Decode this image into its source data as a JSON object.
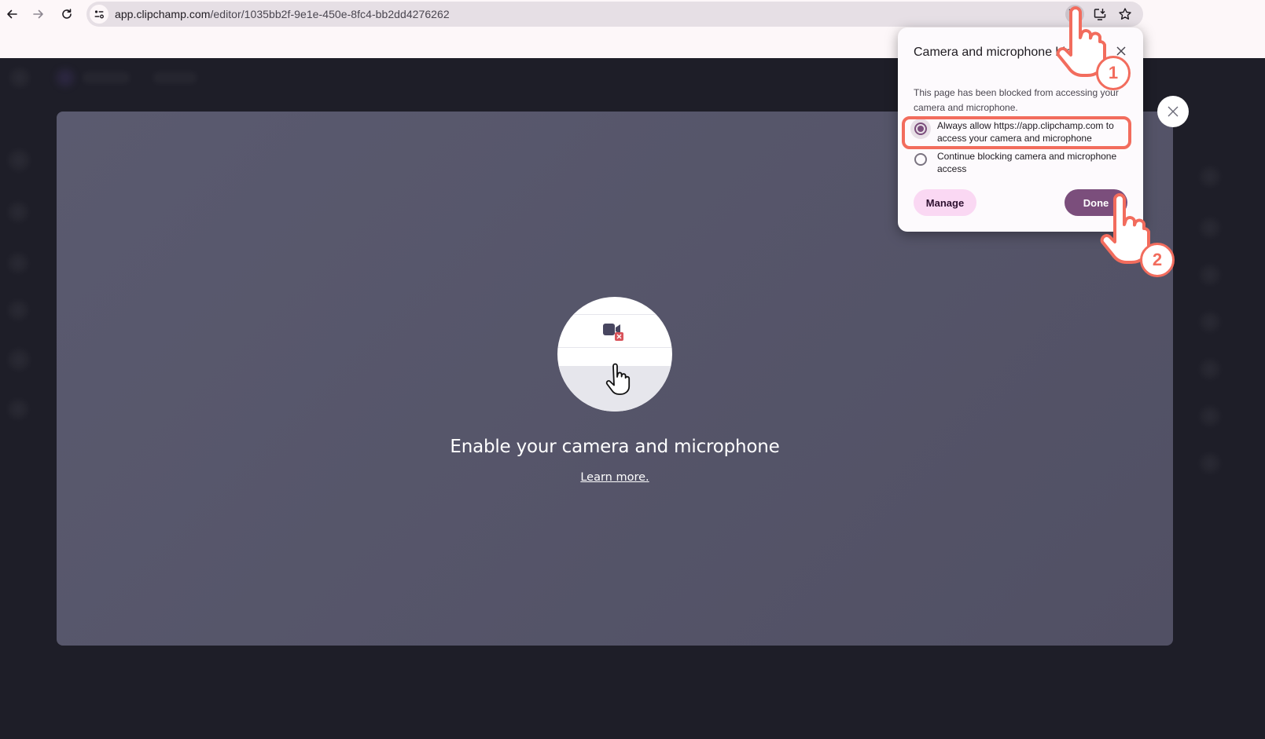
{
  "browser": {
    "url_host": "app.clipchamp.com",
    "url_path": "/editor/1035bb2f-9e1e-450e-8fc4-bb2dd4276262",
    "icons": {
      "back": "arrow-left-icon",
      "forward": "arrow-right-icon",
      "reload": "reload-icon",
      "site_info": "tune-icon",
      "camera_blocked": "camera-blocked-icon",
      "install_app": "install-desktop-icon",
      "bookmark": "star-icon"
    }
  },
  "permission_popup": {
    "title": "Camera and microphone blocked",
    "description": "This page has been blocked from accessing your camera and microphone.",
    "options": [
      {
        "label": "Always allow https://app.clipchamp.com to access your camera and microphone",
        "selected": true
      },
      {
        "label": "Continue blocking camera and microphone access",
        "selected": false
      }
    ],
    "manage_label": "Manage",
    "done_label": "Done"
  },
  "camera_dialog": {
    "title": "Enable your camera and microphone",
    "learn_more": "Learn more."
  },
  "annotations": {
    "step1": "1",
    "step2": "2",
    "highlight_color": "#f26c5d"
  },
  "colors": {
    "accent": "#7b4e7c",
    "manage_bg": "#fad8f3",
    "panel_bg": "#555468",
    "app_bg": "#1e1e28"
  }
}
